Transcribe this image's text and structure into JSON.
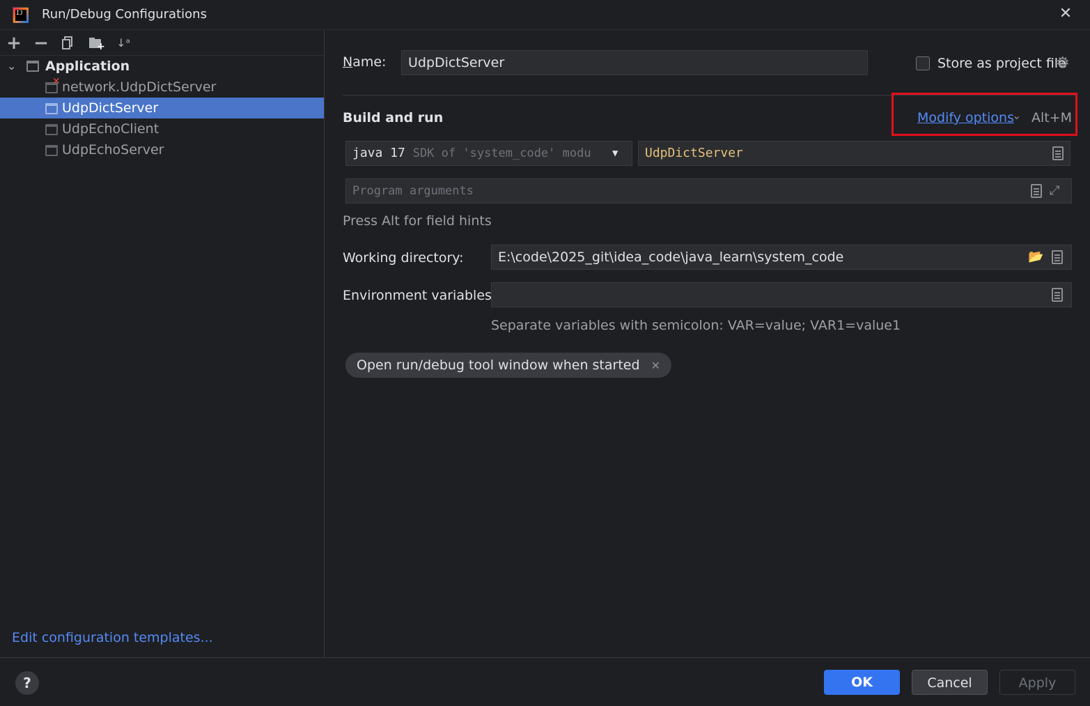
{
  "window": {
    "title": "Run/Debug Configurations"
  },
  "toolbar": {
    "icons": [
      "add-icon",
      "remove-icon",
      "copy-icon",
      "new-folder-icon",
      "sort-icon"
    ]
  },
  "tree": {
    "group_label": "Application",
    "items": [
      {
        "label": "network.UdpDictServer",
        "error": true,
        "selected": false
      },
      {
        "label": "UdpDictServer",
        "error": false,
        "selected": true
      },
      {
        "label": "UdpEchoClient",
        "error": false,
        "selected": false
      },
      {
        "label": "UdpEchoServer",
        "error": false,
        "selected": false
      }
    ]
  },
  "left_footer": {
    "edit_templates": "Edit configuration templates..."
  },
  "form": {
    "name_label": "Name:",
    "name_value": "UdpDictServer",
    "store_label": "Store as project file",
    "store_checked": false,
    "section_title": "Build and run",
    "modify_options": "Modify options",
    "modify_shortcut": "Alt+M",
    "sdk_main": "java 17",
    "sdk_detail": "SDK of 'system_code' modu",
    "main_class": "UdpDictServer",
    "program_args_placeholder": "Program arguments",
    "alt_hint": "Press Alt for field hints",
    "working_dir_label": "Working directory:",
    "working_dir_value": "E:\\code\\2025_git\\idea_code\\java_learn\\system_code",
    "env_label": "Environment variables:",
    "env_value": "",
    "env_hint": "Separate variables with semicolon: VAR=value; VAR1=value1",
    "tag_label": "Open run/debug tool window when started"
  },
  "buttons": {
    "ok": "OK",
    "cancel": "Cancel",
    "apply": "Apply",
    "help": "?"
  },
  "colors": {
    "accent": "#3574f0",
    "link": "#548af7",
    "selection": "#4a75c9",
    "highlight_box": "#e0101a",
    "main_class": "#e5c07b"
  }
}
